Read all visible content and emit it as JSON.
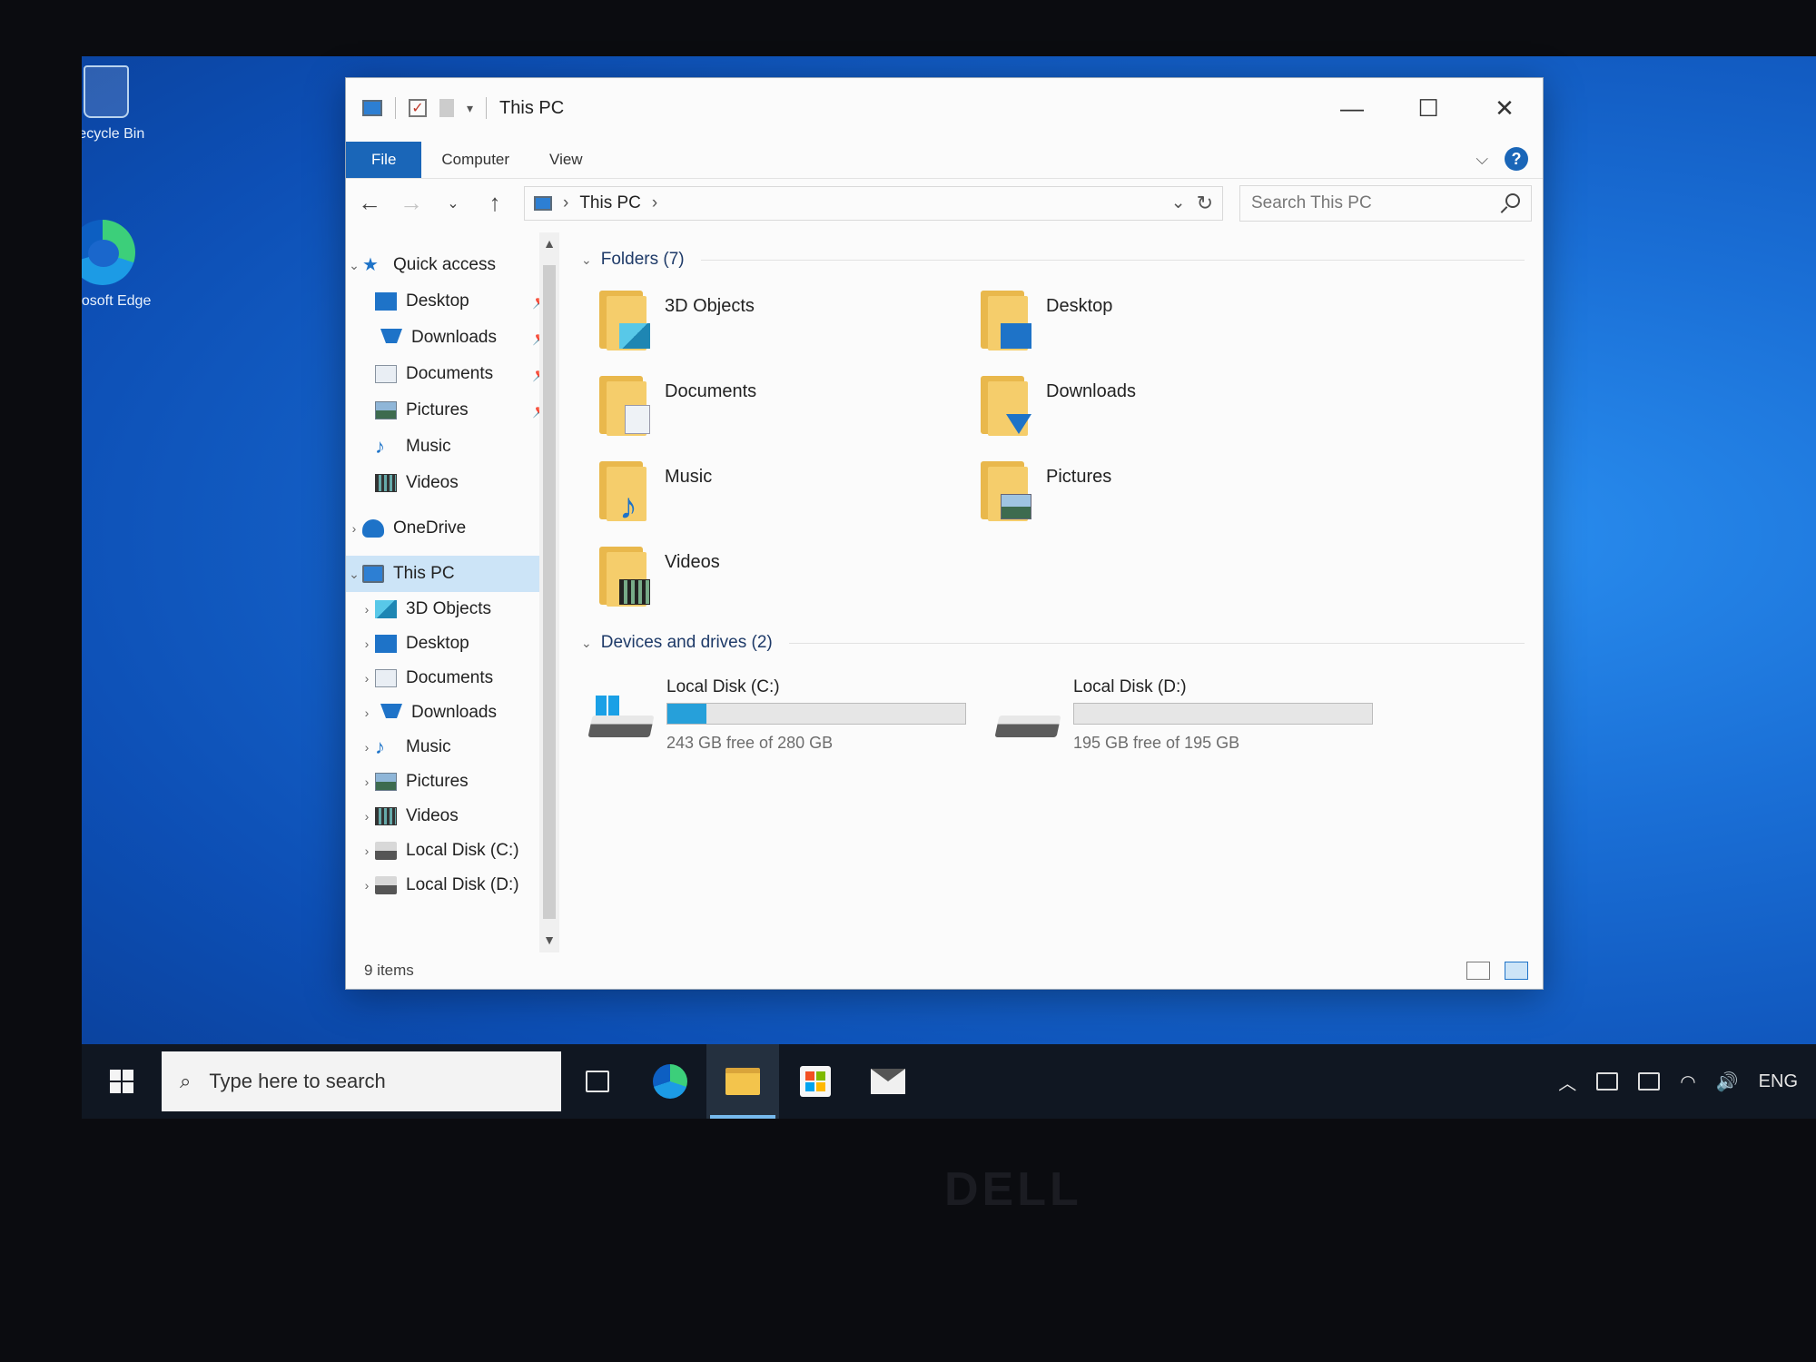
{
  "desktop": {
    "icons": [
      {
        "label": "Recycle Bin"
      },
      {
        "label": "Microsoft Edge"
      }
    ]
  },
  "window": {
    "title": "This PC",
    "controls": {
      "minimize": "—",
      "maximize": "☐",
      "close": "✕"
    },
    "ribbon_tabs": [
      "File",
      "Computer",
      "View"
    ],
    "help": "?",
    "address": {
      "crumb": "This PC"
    },
    "search": {
      "placeholder": "Search This PC"
    },
    "nav": {
      "quick_access": {
        "label": "Quick access",
        "items": [
          {
            "label": "Desktop",
            "pinned": true
          },
          {
            "label": "Downloads",
            "pinned": true
          },
          {
            "label": "Documents",
            "pinned": true
          },
          {
            "label": "Pictures",
            "pinned": true
          },
          {
            "label": "Music",
            "pinned": false
          },
          {
            "label": "Videos",
            "pinned": false
          }
        ]
      },
      "onedrive": "OneDrive",
      "this_pc": {
        "label": "This PC",
        "items": [
          "3D Objects",
          "Desktop",
          "Documents",
          "Downloads",
          "Music",
          "Pictures",
          "Videos",
          "Local Disk (C:)",
          "Local Disk (D:)"
        ]
      }
    },
    "folders_group": "Folders (7)",
    "folders": [
      "3D Objects",
      "Desktop",
      "Documents",
      "Downloads",
      "Music",
      "Pictures",
      "Videos"
    ],
    "devices_group": "Devices and drives (2)",
    "drives": [
      {
        "name": "Local Disk (C:)",
        "free": "243 GB free of 280 GB",
        "used_fraction": 0.13
      },
      {
        "name": "Local Disk (D:)",
        "free": "195 GB free of 195 GB",
        "used_fraction": 0.0
      }
    ],
    "status": "9 items"
  },
  "taskbar": {
    "search_placeholder": "Type here to search",
    "language": "ENG"
  },
  "brand": "DELL",
  "colors": {
    "accent": "#1a66b8",
    "drive_bar": "#26a0da",
    "desktop": "#1a6fd6"
  }
}
